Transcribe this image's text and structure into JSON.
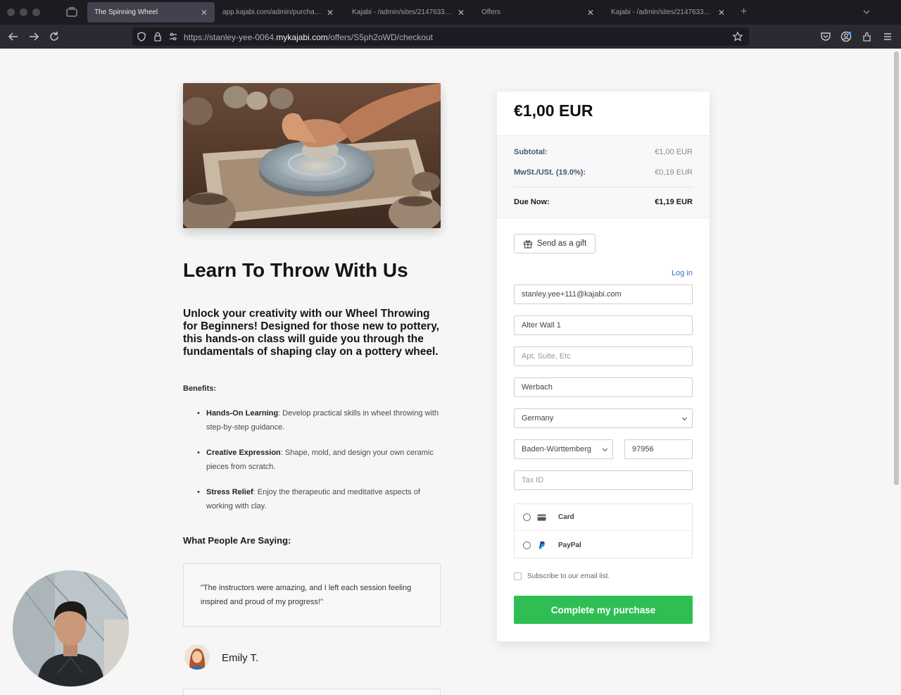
{
  "browser": {
    "tabs": [
      {
        "title": "The Spinning Wheel",
        "active": true
      },
      {
        "title": "app.kajabi.com/admin/purchases/22",
        "active": false
      },
      {
        "title": "Kajabi - /admin/sites/2147633634/s",
        "active": false
      },
      {
        "title": "Offers",
        "active": false
      },
      {
        "title": "Kajabi - /admin/sites/2147633634/s",
        "active": false
      }
    ],
    "url_prefix": "https://stanley-yee-0064.",
    "url_domain": "mykajabi.com",
    "url_path": "/offers/S5ph2oWD/checkout"
  },
  "offer": {
    "title": "Learn To Throw With Us",
    "intro": "Unlock your creativity with our Wheel Throwing for Beginners! Designed for those new to pottery, this hands-on class will guide you through the fundamentals of shaping clay on a pottery wheel.",
    "benefits_heading": "Benefits:",
    "benefits": [
      {
        "name": "Hands-On Learning",
        "text": ": Develop practical skills in wheel throwing with step-by-step guidance."
      },
      {
        "name": "Creative Expression",
        "text": ": Shape, mold, and design your own ceramic pieces from scratch."
      },
      {
        "name": "Stress Relief",
        "text": ": Enjoy the therapeutic and meditative aspects of working with clay."
      }
    ],
    "testimonials_heading": "What People Are Saying:",
    "testimonial_quote": "\"The instructors were amazing, and I left each session feeling inspired and proud of my progress!\"",
    "testimonial_name": "Emily T."
  },
  "checkout": {
    "price": "€1,00 EUR",
    "subtotal_label": "Subtotal:",
    "subtotal_value": "€1,00 EUR",
    "tax_label": "MwSt./USt. (19.0%):",
    "tax_value": "€0,19 EUR",
    "due_label": "Due Now:",
    "due_value": "€1,19 EUR",
    "gift_label": "Send as a gift",
    "login_label": "Log in",
    "email_value": "stanley.yee+111@kajabi.com",
    "address_value": "Alter Wall 1",
    "apt_placeholder": "Apt, Suite, Etc",
    "city_value": "Werbach",
    "country_value": "Germany",
    "state_value": "Baden-Württemberg",
    "zip_value": "97956",
    "taxid_placeholder": "Tax ID",
    "payment_card": "Card",
    "payment_paypal": "PayPal",
    "subscribe_label": "Subscribe to our email list.",
    "submit_label": "Complete my purchase"
  },
  "colors": {
    "accent_green": "#2fbe54",
    "link_blue": "#3a73c5",
    "chrome_dark": "#1c1b22"
  }
}
